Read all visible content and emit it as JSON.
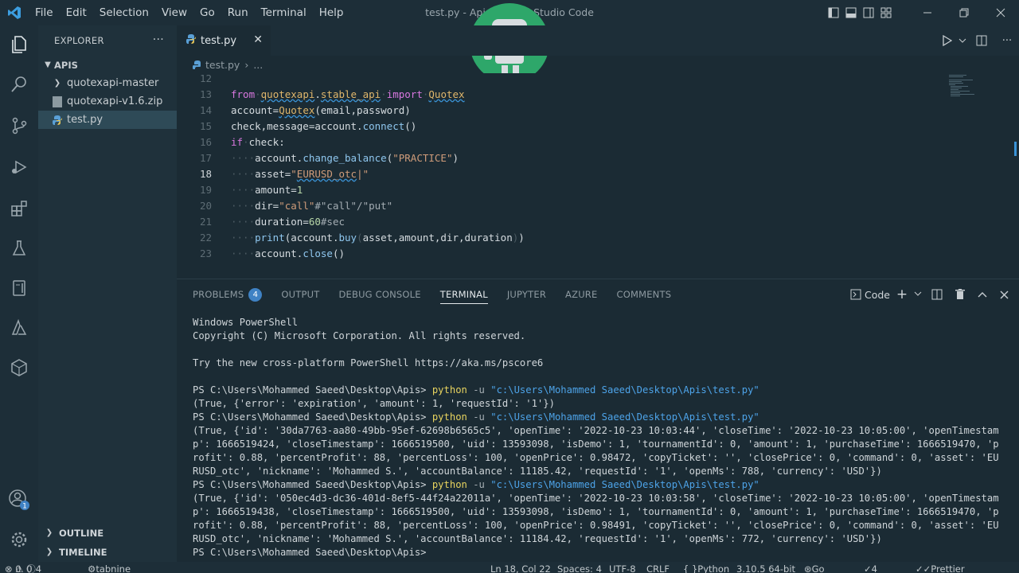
{
  "titlebar": {
    "menu": [
      "File",
      "Edit",
      "Selection",
      "View",
      "Go",
      "Run",
      "Terminal",
      "Help"
    ],
    "title": "test.py - Apis - Visual Studio Code"
  },
  "sidebar": {
    "header": "EXPLORER",
    "more": "···",
    "root": "APIS",
    "items": [
      {
        "label": "quotexapi-master",
        "type": "folder"
      },
      {
        "label": "quotexapi-v1.6.zip",
        "type": "zip"
      },
      {
        "label": "test.py",
        "type": "python"
      }
    ],
    "outline": "OUTLINE",
    "timeline": "TIMELINE"
  },
  "editor": {
    "tab": "test.py",
    "breadcrumb_file": "test.py",
    "breadcrumb_more": "...",
    "line_numbers": [
      "12",
      "13",
      "14",
      "15",
      "16",
      "17",
      "18",
      "19",
      "20",
      "21",
      "22",
      "23"
    ],
    "active_line": "18"
  },
  "panel": {
    "tabs": [
      "PROBLEMS",
      "OUTPUT",
      "DEBUG CONSOLE",
      "TERMINAL",
      "JUPYTER",
      "AZURE",
      "COMMENTS"
    ],
    "problems_count": "4",
    "active_tab": "TERMINAL",
    "shell_label": "Code",
    "terminal": {
      "intro": [
        "Windows PowerShell",
        "Copyright (C) Microsoft Corporation. All rights reserved.",
        "",
        "Try the new cross-platform PowerShell https://aka.ms/pscore6",
        ""
      ],
      "prompt": "PS C:\\Users\\Mohammed Saeed\\Desktop\\Apis> ",
      "cmd": "python",
      "flag": " -u ",
      "script": "\"c:\\Users\\Mohammed Saeed\\Desktop\\Apis\\test.py\"",
      "out1": "(True, {'error': 'expiration', 'amount': 1, 'requestId': '1'})",
      "out2": [
        "(True, {'id': '30da7763-aa80-49bb-95ef-62698b6565c5', 'openTime': '2022-10-23 10:03:44', 'closeTime': '2022-10-23 10:05:00', 'openTimestam",
        "p': 1666519424, 'closeTimestamp': 1666519500, 'uid': 13593098, 'isDemo': 1, 'tournamentId': 0, 'amount': 1, 'purchaseTime': 1666519470, 'p",
        "rofit': 0.88, 'percentProfit': 88, 'percentLoss': 100, 'openPrice': 0.98472, 'copyTicket': '', 'closePrice': 0, 'command': 0, 'asset': 'EU",
        "RUSD_otc', 'nickname': 'Mohammed S.', 'accountBalance': 11185.42, 'requestId': '1', 'openMs': 788, 'currency': 'USD'})"
      ],
      "out3": [
        "(True, {'id': '050ec4d3-dc36-401d-8ef5-44f24a22011a', 'openTime': '2022-10-23 10:03:58', 'closeTime': '2022-10-23 10:05:00', 'openTimestam",
        "p': 1666519438, 'closeTimestamp': 1666519500, 'uid': 13593098, 'isDemo': 1, 'tournamentId': 0, 'amount': 1, 'purchaseTime': 1666519470, 'p",
        "rofit': 0.88, 'percentProfit': 88, 'percentLoss': 100, 'openPrice': 0.98491, 'copyTicket': '', 'closePrice': 0, 'command': 0, 'asset': 'EU",
        "RUSD_otc', 'nickname': 'Mohammed S.', 'accountBalance': 11184.42, 'requestId': '1', 'openMs': 772, 'currency': 'USD'})"
      ]
    }
  },
  "statusbar": {
    "errors": "0",
    "warnings": "0",
    "info": "4",
    "tabnine": "tabnine starter",
    "position": "Ln 18, Col 22",
    "spaces": "Spaces: 4",
    "encoding": "UTF-8",
    "eol": "CRLF",
    "language": "Python",
    "interpreter": "3.10.5 64-bit",
    "golive": "Go Live",
    "spell": "4 Spell",
    "prettier": "Prettier"
  },
  "colors": {
    "accent": "#3f82c4",
    "robot": "#2ea76a"
  }
}
